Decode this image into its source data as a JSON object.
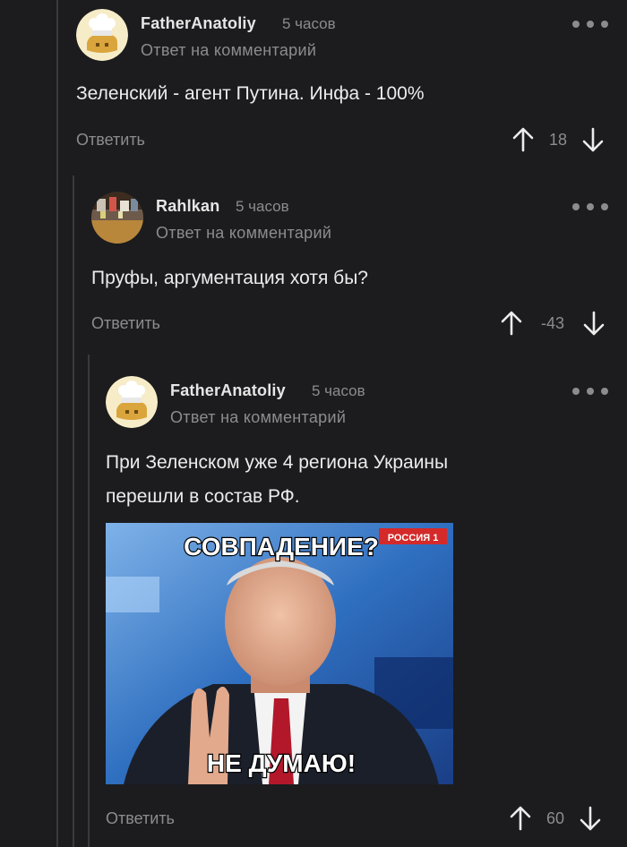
{
  "comments": [
    {
      "author": "FatherAnatoliy",
      "time": "5 часов",
      "reply_to": "Ответ на комментарий",
      "text": "Зеленский - агент Путина. Инфа - 100%",
      "reply": "Ответить",
      "score": "18",
      "avatar_icon": "chef-hat-avatar-icon"
    },
    {
      "author": "Rahlkan",
      "time": "5 часов",
      "reply_to": "Ответ на комментарий",
      "text": "Пруфы, аргументация хотя бы?",
      "reply": "Ответить",
      "score": "-43",
      "avatar_icon": "photo-avatar-icon"
    },
    {
      "author": "FatherAnatoliy",
      "time": "5 часов",
      "reply_to": "Ответ на комментарий",
      "text_line1": "При Зеленском уже 4 региона Украины",
      "text_line2": "перешли в состав РФ.",
      "reply": "Ответить",
      "score": "60",
      "avatar_icon": "chef-hat-avatar-icon",
      "meme": {
        "top_caption": "СОВПАДЕНИЕ?",
        "bottom_caption": "НЕ ДУМАЮ!",
        "channel_logo": "РОССИЯ 1"
      }
    }
  ],
  "colors": {
    "background": "#1c1c1e",
    "muted": "#8c8c90",
    "text": "#ececec"
  }
}
